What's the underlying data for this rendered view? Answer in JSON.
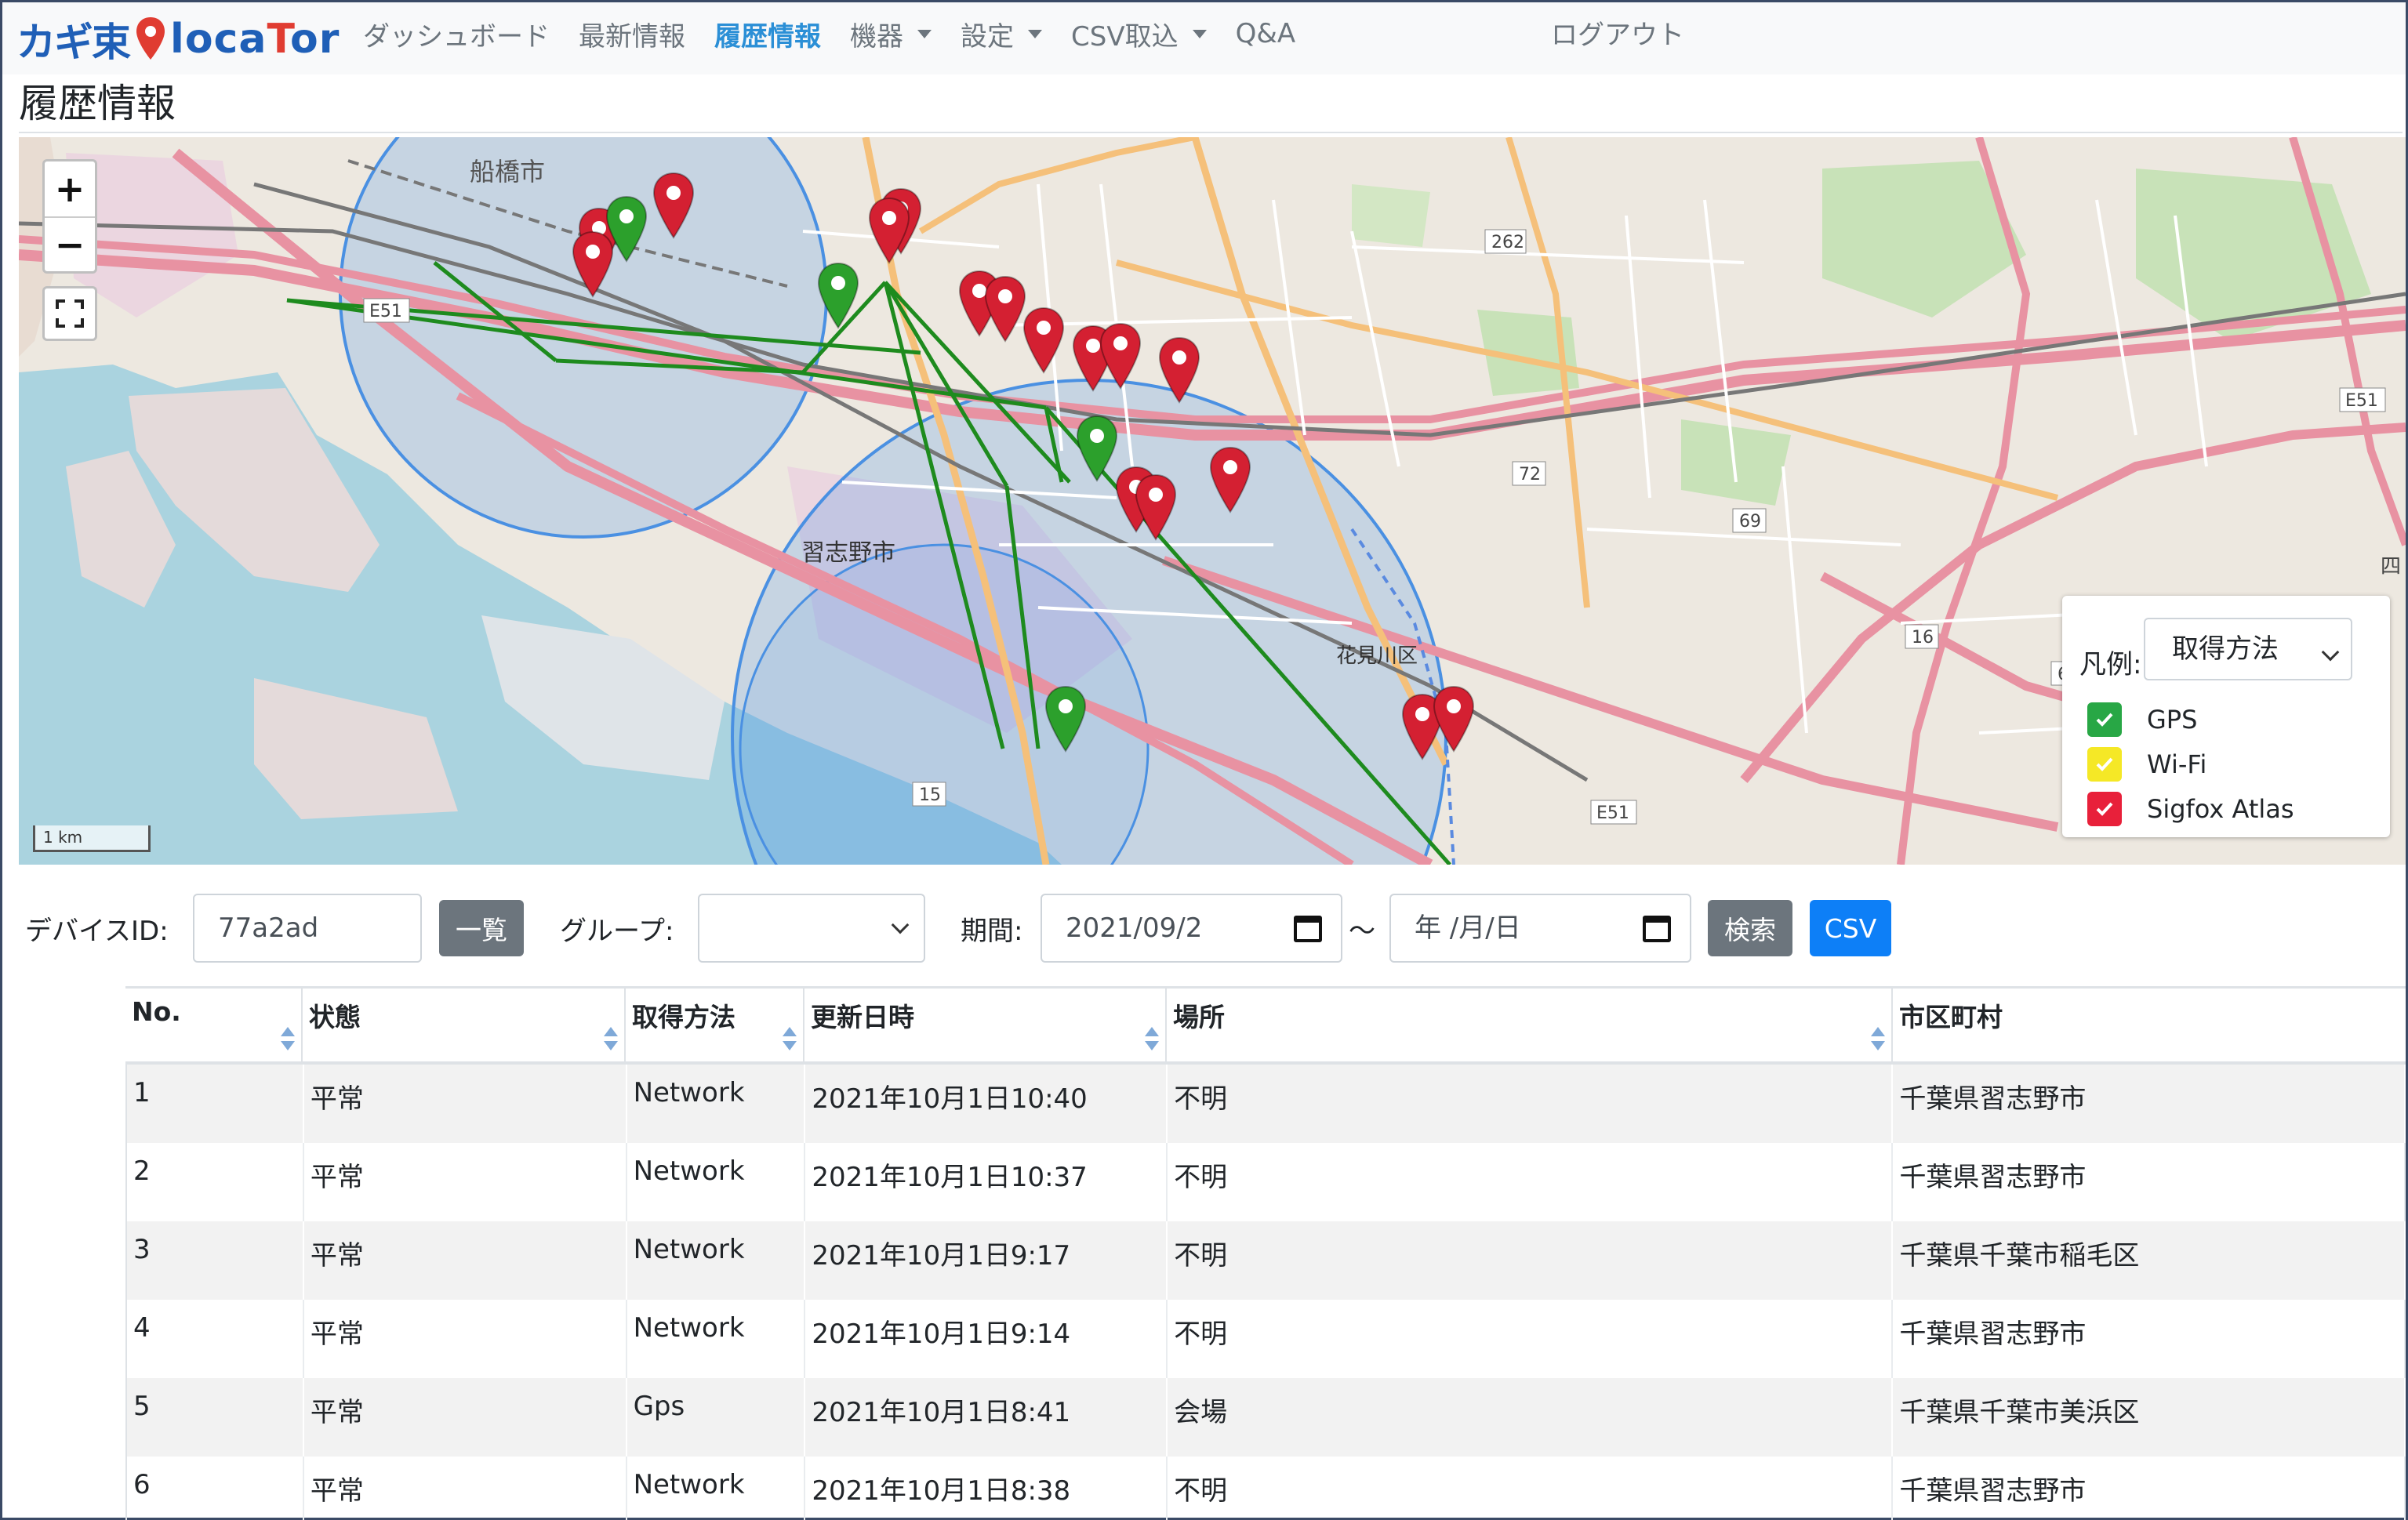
{
  "brand": {
    "jp": "カギ束",
    "en_prefix": "loca",
    "en_mid": "T",
    "en_suffix": "or"
  },
  "nav": {
    "items": [
      {
        "label": "ダッシュボード",
        "active": false,
        "dropdown": false
      },
      {
        "label": "最新情報",
        "active": false,
        "dropdown": false
      },
      {
        "label": "履歴情報",
        "active": true,
        "dropdown": false
      },
      {
        "label": "機器",
        "active": false,
        "dropdown": true
      },
      {
        "label": "設定",
        "active": false,
        "dropdown": true
      },
      {
        "label": "CSV取込",
        "active": false,
        "dropdown": true
      },
      {
        "label": "Q&A",
        "active": false,
        "dropdown": false
      }
    ],
    "logout": "ログアウト"
  },
  "page_title": "履歴情報",
  "map": {
    "zoom_in": "+",
    "zoom_out": "−",
    "scale": "1 km",
    "labels": {
      "city1": "船橋市",
      "city2": "習志野市",
      "ward": "花見川区",
      "e51a": "E51",
      "e51b": "E51",
      "e51c": "E51",
      "r262": "262",
      "r72": "72",
      "r69": "69",
      "r16": "16",
      "r15": "15",
      "r66": "66",
      "r4": "四"
    },
    "marker_colors": {
      "gps": "#2ca02c",
      "network": "#d42032"
    }
  },
  "legend": {
    "label": "凡例:",
    "select": "取得方法",
    "items": [
      {
        "name": "GPS",
        "color": "#28a745"
      },
      {
        "name": "Wi-Fi",
        "color": "#f5e826"
      },
      {
        "name": "Sigfox Atlas",
        "color": "#e8203a"
      }
    ]
  },
  "search": {
    "device_label": "デバイスID:",
    "device_value": "77a2ad",
    "list_button": "一覧",
    "group_label": "グループ:",
    "group_value": "",
    "period_label": "期間:",
    "date_from": "2021/09/2",
    "tilde": "～",
    "date_to": "年 /月/日",
    "search_button": "検索",
    "csv_button": "CSV"
  },
  "table": {
    "headers": [
      "No.",
      "状態",
      "取得方法",
      "更新日時",
      "場所",
      "市区町村"
    ],
    "rows": [
      [
        "1",
        "平常",
        "Network",
        "2021年10月1日10:40",
        "不明",
        "千葉県習志野市"
      ],
      [
        "2",
        "平常",
        "Network",
        "2021年10月1日10:37",
        "不明",
        "千葉県習志野市"
      ],
      [
        "3",
        "平常",
        "Network",
        "2021年10月1日9:17",
        "不明",
        "千葉県千葉市稲毛区"
      ],
      [
        "4",
        "平常",
        "Network",
        "2021年10月1日9:14",
        "不明",
        "千葉県習志野市"
      ],
      [
        "5",
        "平常",
        "Gps",
        "2021年10月1日8:41",
        "会場",
        "千葉県千葉市美浜区"
      ],
      [
        "6",
        "平常",
        "Network",
        "2021年10月1日8:38",
        "不明",
        "千葉県習志野市"
      ]
    ]
  }
}
